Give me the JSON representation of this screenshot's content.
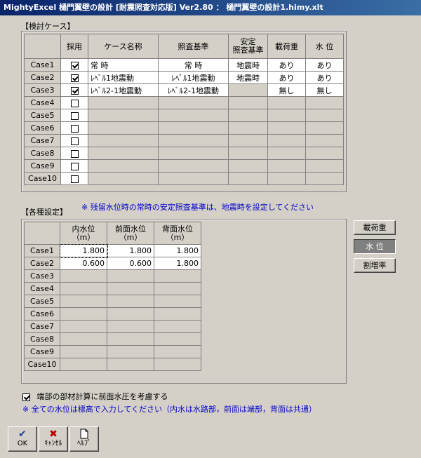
{
  "window": {
    "title": "MightyExcel 樋門翼壁の設計 [耐震照査対応版] Ver2.80 ： 樋門翼壁の設計1.himy.xlt"
  },
  "cases_section": {
    "label": "【検討ケース】",
    "headers": [
      "採用",
      "ケース名称",
      "照査基準",
      "安定\n照査基準",
      "載荷重",
      "水 位"
    ],
    "rows": [
      {
        "name": "Case1",
        "adopt": true,
        "case_name": "常 時",
        "criteria": "常 時",
        "stability": "地震時",
        "load": "あり",
        "water": "あり"
      },
      {
        "name": "Case2",
        "adopt": true,
        "case_name": "ﾚﾍﾞﾙ1地震動",
        "criteria": "ﾚﾍﾞﾙ1地震動",
        "stability": "地震時",
        "load": "あり",
        "water": "あり"
      },
      {
        "name": "Case3",
        "adopt": true,
        "case_name": "ﾚﾍﾞﾙ2-1地震動",
        "criteria": "ﾚﾍﾞﾙ2-1地震動",
        "stability": "",
        "load": "無し",
        "water": "無し"
      },
      {
        "name": "Case4",
        "adopt": false
      },
      {
        "name": "Case5",
        "adopt": false
      },
      {
        "name": "Case6",
        "adopt": false
      },
      {
        "name": "Case7",
        "adopt": false
      },
      {
        "name": "Case8",
        "adopt": false
      },
      {
        "name": "Case9",
        "adopt": false
      },
      {
        "name": "Case10",
        "adopt": false
      }
    ]
  },
  "notes": {
    "residual": "※ 残留水位時の常時の安定照査基準は、地震時を設定してください",
    "all_water": "※ 全ての水位は標高で入力してください（内水は水路部，前面は端部，背面は共通）"
  },
  "settings_section": {
    "label": "【各種設定】",
    "headers": [
      "内水位\n（m）",
      "前面水位\n（m）",
      "背面水位\n（m）"
    ],
    "rows": [
      {
        "name": "Case1",
        "inner": "1.800",
        "front": "1.800",
        "back": "1.800"
      },
      {
        "name": "Case2",
        "inner": "0.600",
        "front": "0.600",
        "back": "1.800"
      },
      {
        "name": "Case3"
      },
      {
        "name": "Case4"
      },
      {
        "name": "Case5"
      },
      {
        "name": "Case6"
      },
      {
        "name": "Case7"
      },
      {
        "name": "Case8"
      },
      {
        "name": "Case9"
      },
      {
        "name": "Case10"
      }
    ]
  },
  "side_buttons": {
    "load": "載荷重",
    "water": "水 位",
    "rate": "割増率"
  },
  "option": {
    "label": "端部の部材計算に前面水圧を考慮する",
    "checked": true
  },
  "buttons": {
    "ok": "OK",
    "cancel": "ｷｬﾝｾﾙ",
    "help": "ﾍﾙﾌﾟ"
  }
}
